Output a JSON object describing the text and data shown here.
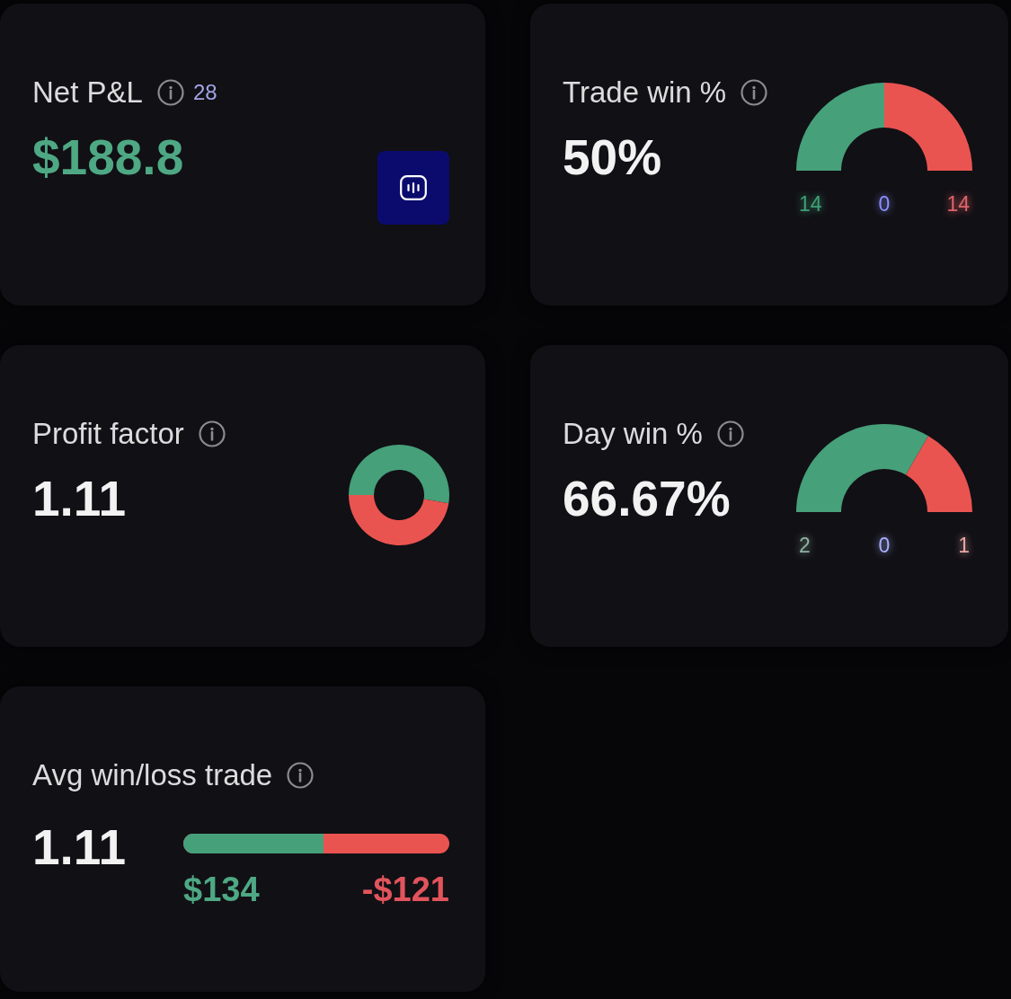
{
  "cards": [
    {
      "kind": "button",
      "title": "Net P&L",
      "count": "28",
      "value": "$188.8",
      "positive": true
    },
    {
      "kind": "gauge",
      "title": "Trade win %",
      "value": "50%",
      "positive": false,
      "legend": [
        {
          "label": "14",
          "color": "#3f9f76"
        },
        {
          "label": "0",
          "color": "#8a90ff"
        },
        {
          "label": "14",
          "color": "#e0646a"
        }
      ]
    },
    {
      "kind": "donut",
      "title": "Profit factor",
      "value": "1.11",
      "positive": false
    },
    {
      "kind": "gauge",
      "title": "Day win %",
      "value": "66.67%",
      "positive": false,
      "legend": [
        {
          "label": "2",
          "color": "#8fb3a1"
        },
        {
          "label": "0",
          "color": "#a8b0ff"
        },
        {
          "label": "1",
          "color": "#e8a8a8"
        }
      ]
    },
    {
      "kind": "bar",
      "title": "Avg win/loss trade",
      "value": "1.11",
      "positive": false,
      "level": 0.526,
      "bar_labels": {
        "win": "$134",
        "loss": "-$121"
      }
    }
  ]
}
